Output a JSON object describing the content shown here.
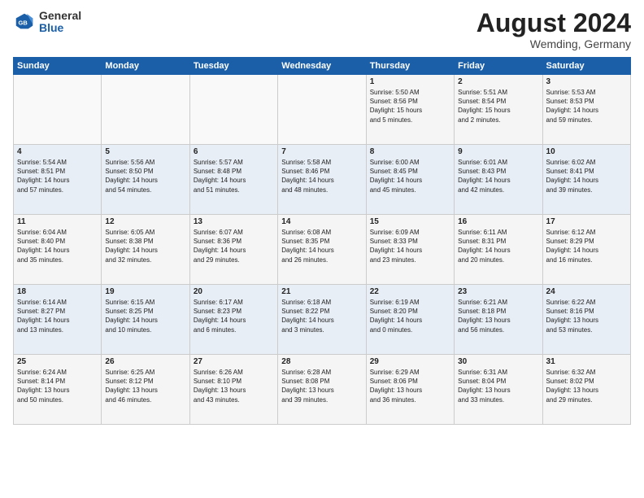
{
  "header": {
    "logo_general": "General",
    "logo_blue": "Blue",
    "month_title": "August 2024",
    "location": "Wemding, Germany"
  },
  "weekdays": [
    "Sunday",
    "Monday",
    "Tuesday",
    "Wednesday",
    "Thursday",
    "Friday",
    "Saturday"
  ],
  "weeks": [
    [
      {
        "day": "",
        "info": ""
      },
      {
        "day": "",
        "info": ""
      },
      {
        "day": "",
        "info": ""
      },
      {
        "day": "",
        "info": ""
      },
      {
        "day": "1",
        "info": "Sunrise: 5:50 AM\nSunset: 8:56 PM\nDaylight: 15 hours\nand 5 minutes."
      },
      {
        "day": "2",
        "info": "Sunrise: 5:51 AM\nSunset: 8:54 PM\nDaylight: 15 hours\nand 2 minutes."
      },
      {
        "day": "3",
        "info": "Sunrise: 5:53 AM\nSunset: 8:53 PM\nDaylight: 14 hours\nand 59 minutes."
      }
    ],
    [
      {
        "day": "4",
        "info": "Sunrise: 5:54 AM\nSunset: 8:51 PM\nDaylight: 14 hours\nand 57 minutes."
      },
      {
        "day": "5",
        "info": "Sunrise: 5:56 AM\nSunset: 8:50 PM\nDaylight: 14 hours\nand 54 minutes."
      },
      {
        "day": "6",
        "info": "Sunrise: 5:57 AM\nSunset: 8:48 PM\nDaylight: 14 hours\nand 51 minutes."
      },
      {
        "day": "7",
        "info": "Sunrise: 5:58 AM\nSunset: 8:46 PM\nDaylight: 14 hours\nand 48 minutes."
      },
      {
        "day": "8",
        "info": "Sunrise: 6:00 AM\nSunset: 8:45 PM\nDaylight: 14 hours\nand 45 minutes."
      },
      {
        "day": "9",
        "info": "Sunrise: 6:01 AM\nSunset: 8:43 PM\nDaylight: 14 hours\nand 42 minutes."
      },
      {
        "day": "10",
        "info": "Sunrise: 6:02 AM\nSunset: 8:41 PM\nDaylight: 14 hours\nand 39 minutes."
      }
    ],
    [
      {
        "day": "11",
        "info": "Sunrise: 6:04 AM\nSunset: 8:40 PM\nDaylight: 14 hours\nand 35 minutes."
      },
      {
        "day": "12",
        "info": "Sunrise: 6:05 AM\nSunset: 8:38 PM\nDaylight: 14 hours\nand 32 minutes."
      },
      {
        "day": "13",
        "info": "Sunrise: 6:07 AM\nSunset: 8:36 PM\nDaylight: 14 hours\nand 29 minutes."
      },
      {
        "day": "14",
        "info": "Sunrise: 6:08 AM\nSunset: 8:35 PM\nDaylight: 14 hours\nand 26 minutes."
      },
      {
        "day": "15",
        "info": "Sunrise: 6:09 AM\nSunset: 8:33 PM\nDaylight: 14 hours\nand 23 minutes."
      },
      {
        "day": "16",
        "info": "Sunrise: 6:11 AM\nSunset: 8:31 PM\nDaylight: 14 hours\nand 20 minutes."
      },
      {
        "day": "17",
        "info": "Sunrise: 6:12 AM\nSunset: 8:29 PM\nDaylight: 14 hours\nand 16 minutes."
      }
    ],
    [
      {
        "day": "18",
        "info": "Sunrise: 6:14 AM\nSunset: 8:27 PM\nDaylight: 14 hours\nand 13 minutes."
      },
      {
        "day": "19",
        "info": "Sunrise: 6:15 AM\nSunset: 8:25 PM\nDaylight: 14 hours\nand 10 minutes."
      },
      {
        "day": "20",
        "info": "Sunrise: 6:17 AM\nSunset: 8:23 PM\nDaylight: 14 hours\nand 6 minutes."
      },
      {
        "day": "21",
        "info": "Sunrise: 6:18 AM\nSunset: 8:22 PM\nDaylight: 14 hours\nand 3 minutes."
      },
      {
        "day": "22",
        "info": "Sunrise: 6:19 AM\nSunset: 8:20 PM\nDaylight: 14 hours\nand 0 minutes."
      },
      {
        "day": "23",
        "info": "Sunrise: 6:21 AM\nSunset: 8:18 PM\nDaylight: 13 hours\nand 56 minutes."
      },
      {
        "day": "24",
        "info": "Sunrise: 6:22 AM\nSunset: 8:16 PM\nDaylight: 13 hours\nand 53 minutes."
      }
    ],
    [
      {
        "day": "25",
        "info": "Sunrise: 6:24 AM\nSunset: 8:14 PM\nDaylight: 13 hours\nand 50 minutes."
      },
      {
        "day": "26",
        "info": "Sunrise: 6:25 AM\nSunset: 8:12 PM\nDaylight: 13 hours\nand 46 minutes."
      },
      {
        "day": "27",
        "info": "Sunrise: 6:26 AM\nSunset: 8:10 PM\nDaylight: 13 hours\nand 43 minutes."
      },
      {
        "day": "28",
        "info": "Sunrise: 6:28 AM\nSunset: 8:08 PM\nDaylight: 13 hours\nand 39 minutes."
      },
      {
        "day": "29",
        "info": "Sunrise: 6:29 AM\nSunset: 8:06 PM\nDaylight: 13 hours\nand 36 minutes."
      },
      {
        "day": "30",
        "info": "Sunrise: 6:31 AM\nSunset: 8:04 PM\nDaylight: 13 hours\nand 33 minutes."
      },
      {
        "day": "31",
        "info": "Sunrise: 6:32 AM\nSunset: 8:02 PM\nDaylight: 13 hours\nand 29 minutes."
      }
    ]
  ]
}
